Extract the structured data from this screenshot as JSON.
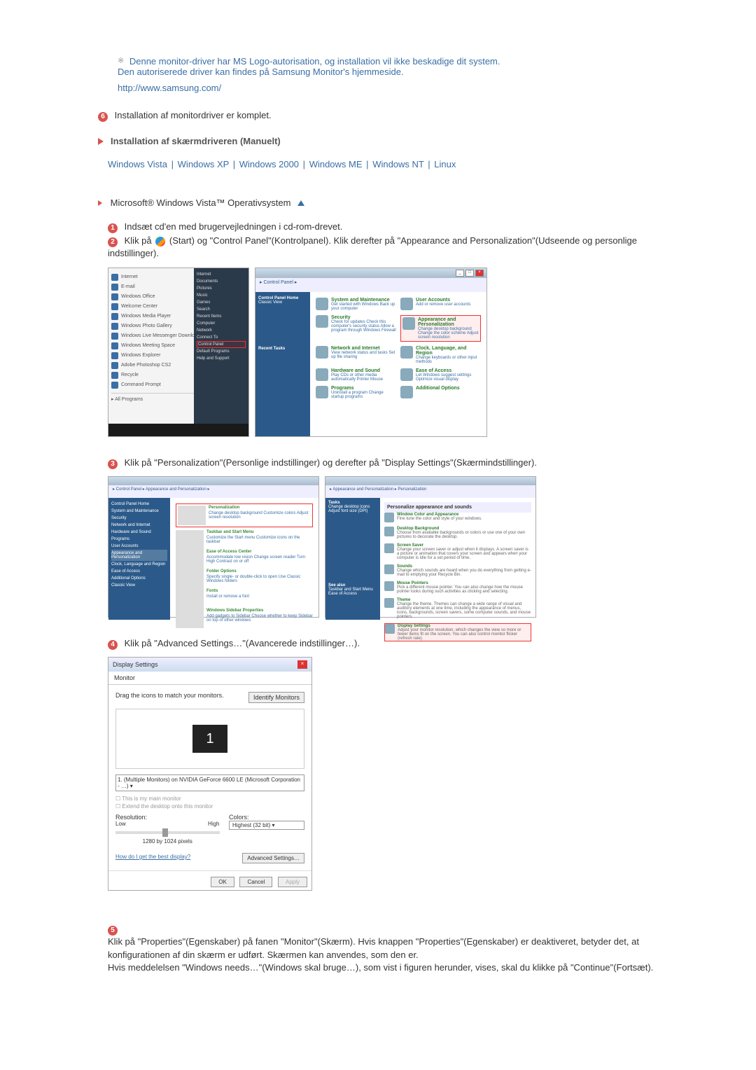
{
  "note": {
    "line1": "Denne monitor-driver har MS Logo-autorisation, og installation vil ikke beskadige dit system.",
    "line2": "Den autoriserede driver kan findes på Samsung Monitor's hjemmeside.",
    "url": "http://www.samsung.com/"
  },
  "step6_label": "6",
  "step6_text": "Installation af monitordriver er komplet.",
  "manual_header": "Installation af skærmdriveren (Manuelt)",
  "os": {
    "vista": "Windows Vista",
    "xp": "Windows XP",
    "w2000": "Windows 2000",
    "me": "Windows ME",
    "nt": "Windows NT",
    "linux": "Linux"
  },
  "os_title": "Microsoft® Windows Vista™ Operativsystem",
  "steps": {
    "s1": {
      "num": "1",
      "text": "Indsæt cd'en med brugervejledningen i cd-rom-drevet."
    },
    "s2": {
      "num": "2",
      "text_a": "Klik på ",
      "text_b": "(Start) og \"Control Panel\"(Kontrolpanel). Klik derefter på \"Appearance and Personalization\"(Udseende og personlige indstillinger)."
    },
    "s3": {
      "num": "3",
      "text": "Klik på \"Personalization\"(Personlige indstillinger) og derefter på \"Display Settings\"(Skærmindstillinger)."
    },
    "s4": {
      "num": "4",
      "text": "Klik på \"Advanced Settings…\"(Avancerede indstillinger…)."
    },
    "s5": {
      "num": "5",
      "text": "Klik på \"Properties\"(Egenskaber) på fanen \"Monitor\"(Skærm). Hvis knappen \"Properties\"(Egenskaber) er deaktiveret, betyder det, at konfigurationen af din skærm er udført. Skærmen kan anvendes, som den er.\nHvis meddelelsen \"Windows needs…\"(Windows skal bruge…), som vist i figuren herunder, vises, skal du klikke på \"Continue\"(Fortsæt)."
    }
  },
  "mock": {
    "startmenu": {
      "items": [
        "Internet",
        "E-mail",
        "Windows Office",
        "Welcome Center",
        "Windows Media Player",
        "Windows Photo Gallery",
        "Windows Live Messenger Download",
        "Windows Meeting Space",
        "Windows Explorer",
        "Adobe Photoshop CS2",
        "Recycle",
        "Command Prompt"
      ],
      "all": "All Programs",
      "side": [
        "Internet",
        "Documents",
        "Pictures",
        "Music",
        "Games",
        "Search",
        "Recent Items",
        "Computer",
        "Network",
        "Connect To",
        "Control Panel",
        "Default Programs",
        "Help and Support"
      ]
    },
    "cp": {
      "crumb": "▸ Control Panel ▸",
      "nav_title": "Control Panel Home",
      "nav_classic": "Classic View",
      "recent": "Recent Tasks",
      "cats": [
        {
          "title": "System and Maintenance",
          "sub": "Get started with Windows   Back up your computer"
        },
        {
          "title": "User Accounts",
          "sub": "Add or remove user accounts"
        },
        {
          "title": "Security",
          "sub": "Check for updates   Check this computer's security status   Allow a program through Windows Firewall"
        },
        {
          "title": "Appearance and Personalization",
          "sub": "Change desktop background   Change the color scheme   Adjust screen resolution",
          "hl": true
        },
        {
          "title": "Network and Internet",
          "sub": "View network status and tasks   Set up file sharing"
        },
        {
          "title": "Clock, Language, and Region",
          "sub": "Change keyboards or other input methods"
        },
        {
          "title": "Hardware and Sound",
          "sub": "Play CDs or other media automatically   Printer   Mouse"
        },
        {
          "title": "Ease of Access",
          "sub": "Let Windows suggest settings   Optimize visual display"
        },
        {
          "title": "Programs",
          "sub": "Uninstall a program   Change startup programs"
        },
        {
          "title": "Additional Options",
          "sub": ""
        }
      ]
    },
    "ap": {
      "crumb": "▸ Control Panel ▸ Appearance and Personalization ▸",
      "items": [
        {
          "t": "Personalization",
          "d": "Change desktop background   Customize colors   Adjust screen resolution"
        },
        {
          "t": "Taskbar and Start Menu",
          "d": "Customize the Start menu   Customize icons on the taskbar"
        },
        {
          "t": "Ease of Access Center",
          "d": "Accommodate low vision   Change screen reader   Turn High Contrast on or off"
        },
        {
          "t": "Folder Options",
          "d": "Specify single- or double-click to open   Use Classic Windows folders"
        },
        {
          "t": "Fonts",
          "d": "Install or remove a font"
        },
        {
          "t": "Windows Sidebar Properties",
          "d": "Add gadgets to Sidebar   Choose whether to keep Sidebar on top of other windows"
        }
      ],
      "nav": [
        "Control Panel Home",
        "System and Maintenance",
        "Security",
        "Network and Internet",
        "Hardware and Sound",
        "Programs",
        "User Accounts",
        "Appearance and Personalization",
        "Clock, Language and Region",
        "Ease of Access",
        "Additional Options",
        "Classic View"
      ]
    },
    "pers": {
      "crumb": "▸ Appearance and Personalization ▸ Personalization",
      "hdr": "Personalize appearance and sounds",
      "nav": [
        "Tasks",
        "Change desktop icons",
        "Adjust font size (DPI)"
      ],
      "items": [
        {
          "t": "Window Color and Appearance",
          "d": "Fine tune the color and style of your windows."
        },
        {
          "t": "Desktop Background",
          "d": "Choose from available backgrounds or colors or use one of your own pictures to decorate the desktop."
        },
        {
          "t": "Screen Saver",
          "d": "Change your screen saver or adjust when it displays. A screen saver is a picture or animation that covers your screen and appears when your computer is idle for a set period of time."
        },
        {
          "t": "Sounds",
          "d": "Change which sounds are heard when you do everything from getting e-mail to emptying your Recycle Bin."
        },
        {
          "t": "Mouse Pointers",
          "d": "Pick a different mouse pointer. You can also change how the mouse pointer looks during such activities as clicking and selecting."
        },
        {
          "t": "Theme",
          "d": "Change the theme. Themes can change a wide range of visual and auditory elements at one time, including the appearance of menus, icons, backgrounds, screen savers, some computer sounds, and mouse pointers."
        },
        {
          "t": "Display Settings",
          "d": "Adjust your monitor resolution, which changes the view so more or fewer items fit on the screen. You can also control monitor flicker (refresh rate)."
        }
      ],
      "see_also": "See also",
      "see_items": [
        "Taskbar and Start Menu",
        "Ease of Access"
      ]
    },
    "ds": {
      "title": "Display Settings",
      "tab": "Monitor",
      "drag": "Drag the icons to match your monitors.",
      "identify": "Identify Monitors",
      "mon_num": "1",
      "sel": "1. (Multiple Monitors) on NVIDIA GeForce 6600 LE (Microsoft Corporation - …)",
      "chk1": "This is my main monitor",
      "chk2": "Extend the desktop onto this monitor",
      "res_lbl": "Resolution:",
      "low": "Low",
      "high": "High",
      "res_val": "1280 by 1024 pixels",
      "col_lbl": "Colors:",
      "col_val": "Highest (32 bit)",
      "help": "How do I get the best display?",
      "adv": "Advanced Settings…",
      "ok": "OK",
      "cancel": "Cancel",
      "apply": "Apply"
    }
  }
}
